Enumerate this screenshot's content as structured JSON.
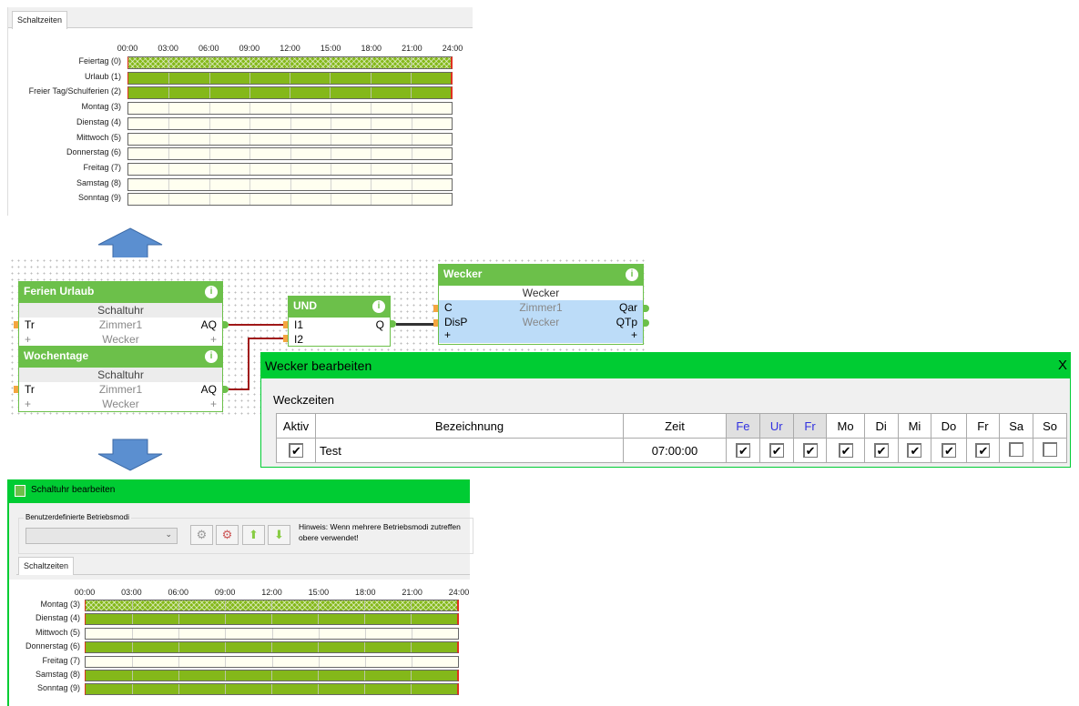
{
  "top_panel": {
    "tab": "Schaltzeiten",
    "axis": [
      "00:00",
      "03:00",
      "06:00",
      "09:00",
      "12:00",
      "15:00",
      "18:00",
      "21:00",
      "24:00"
    ],
    "rows": [
      {
        "label": "Feiertag (0)",
        "state": "hatched"
      },
      {
        "label": "Urlaub (1)",
        "state": "on"
      },
      {
        "label": "Freier Tag/Schulferien (2)",
        "state": "on"
      },
      {
        "label": "Montag (3)",
        "state": "off"
      },
      {
        "label": "Dienstag (4)",
        "state": "off"
      },
      {
        "label": "Mittwoch (5)",
        "state": "off"
      },
      {
        "label": "Donnerstag (6)",
        "state": "off"
      },
      {
        "label": "Freitag (7)",
        "state": "off"
      },
      {
        "label": "Samstag (8)",
        "state": "off"
      },
      {
        "label": "Sonntag (9)",
        "state": "off"
      }
    ]
  },
  "diagram": {
    "ferien": {
      "title": "Ferien Urlaub",
      "type": "Schaltuhr",
      "in": "Tr",
      "room": "Zimmer1",
      "out": "AQ",
      "sub": "Wecker"
    },
    "wochentage": {
      "title": "Wochentage",
      "type": "Schaltuhr",
      "in": "Tr",
      "room": "Zimmer1",
      "out": "AQ",
      "sub": "Wecker"
    },
    "und": {
      "title": "UND",
      "in1": "I1",
      "in2": "I2",
      "out": "Q"
    },
    "wecker": {
      "title": "Wecker",
      "type": "Wecker",
      "in1": "C",
      "in2": "DisP",
      "room": "Zimmer1",
      "sub": "Wecker",
      "out1": "Qar",
      "out2": "QTp"
    },
    "info": "i",
    "plus": "+"
  },
  "wecker_dialog": {
    "title": "Wecker bearbeiten",
    "close": "X",
    "section": "Weckzeiten",
    "columns": [
      "Aktiv",
      "Bezeichnung",
      "Zeit",
      "Fe",
      "Ur",
      "Fr",
      "Mo",
      "Di",
      "Mi",
      "Do",
      "Fr",
      "Sa",
      "So"
    ],
    "row": {
      "aktiv": true,
      "name": "Test",
      "time": "07:00:00",
      "days": [
        true,
        true,
        true,
        true,
        true,
        true,
        true,
        true,
        false,
        false
      ]
    },
    "check": "✔",
    "colors": {
      "titlebar": "#00cc33",
      "special": "#3030e0"
    }
  },
  "schaltuhr_dialog": {
    "title": "Schaltuhr bearbeiten",
    "group": "Benutzerdefinierte Betriebsmodi",
    "combo_value": "",
    "hint_line1": "Hinweis: Wenn mehrere Betriebsmodi zutreffen",
    "hint_line2": "obere verwendet!",
    "tab": "Schaltzeiten",
    "axis": [
      "00:00",
      "03:00",
      "06:00",
      "09:00",
      "12:00",
      "15:00",
      "18:00",
      "21:00",
      "24:00"
    ],
    "rows": [
      {
        "label": "Montag (3)",
        "state": "hatched"
      },
      {
        "label": "Dienstag (4)",
        "state": "on"
      },
      {
        "label": "Mittwoch (5)",
        "state": "off"
      },
      {
        "label": "Donnerstag (6)",
        "state": "on"
      },
      {
        "label": "Freitag (7)",
        "state": "off"
      },
      {
        "label": "Samstag (8)",
        "state": "on"
      },
      {
        "label": "Sonntag (9)",
        "state": "on"
      }
    ]
  }
}
